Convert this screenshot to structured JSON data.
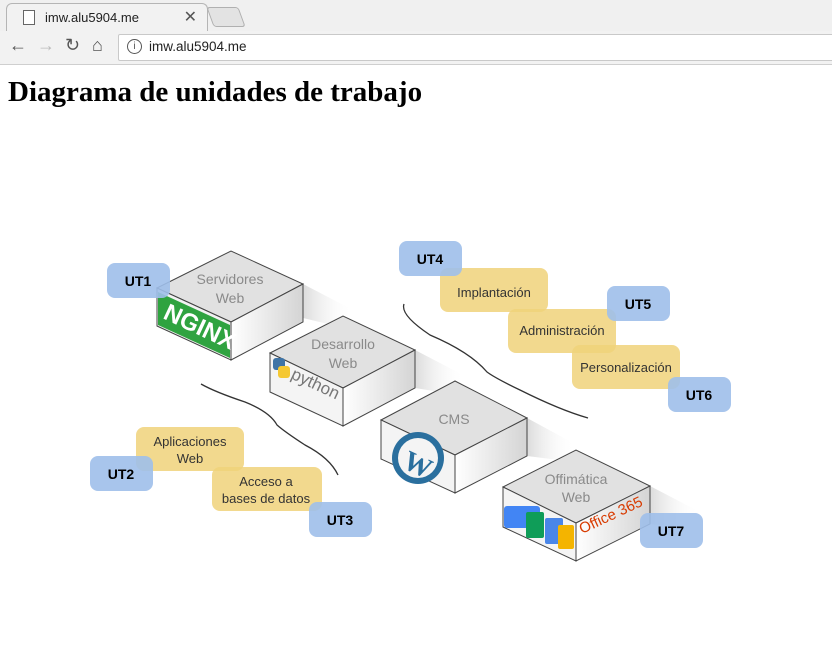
{
  "browser": {
    "tab_title": "imw.alu5904.me",
    "url": "imw.alu5904.me",
    "close_glyph": "✕",
    "icons": [
      "page-icon",
      "back-icon",
      "forward-icon",
      "reload-icon",
      "home-icon",
      "info-icon"
    ]
  },
  "page": {
    "heading": "Diagrama de unidades de trabajo"
  },
  "diagram": {
    "boxes": [
      {
        "line1": "Servidores",
        "line2": "Web"
      },
      {
        "line1": "Desarrollo",
        "line2": "Web"
      },
      {
        "line1": "CMS",
        "line2": ""
      },
      {
        "line1": "Offimática",
        "line2": "Web"
      }
    ],
    "units": [
      "UT1",
      "UT2",
      "UT3",
      "UT4",
      "UT5",
      "UT6",
      "UT7"
    ],
    "topics": [
      {
        "line1": "Aplicaciones",
        "line2": "Web"
      },
      {
        "line1": "Acceso a",
        "line2": "bases de datos"
      },
      {
        "line1": "Implantación",
        "line2": ""
      },
      {
        "line1": "Administración",
        "line2": ""
      },
      {
        "line1": "Personalización",
        "line2": ""
      }
    ],
    "logo_texts": [
      "NGINX",
      "python",
      "Office 365"
    ],
    "colors": {
      "unit_fill": "#9fbfea",
      "topic_fill": "#f0d27a",
      "box_top": "#e0e0e0",
      "box_side": "#f4f4f4"
    }
  }
}
